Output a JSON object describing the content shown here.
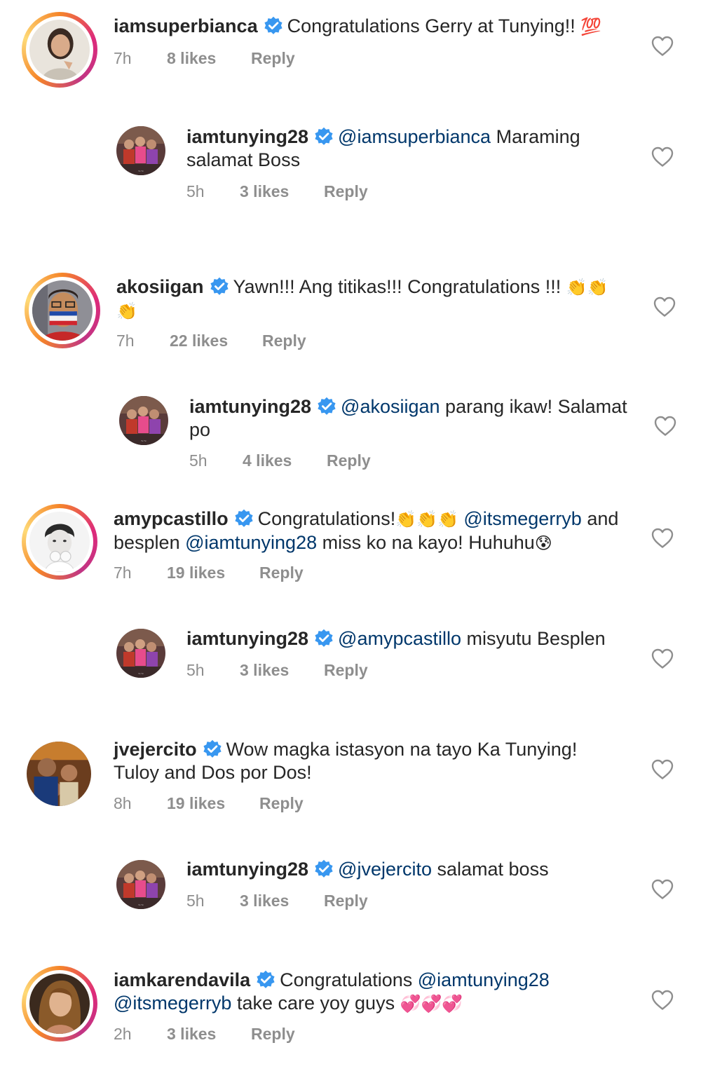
{
  "verified_color": "#3897f0",
  "mention_color": "#00376b",
  "comments": [
    {
      "username": "iamsuperbianca",
      "text_parts": [
        {
          "t": "Congratulations Gerry at Tunying!! "
        },
        {
          "emoji": "💯"
        }
      ],
      "time": "7h",
      "likes": "8 likes",
      "reply": "Reply",
      "icon": "heart-icon"
    },
    {
      "username": "iamtunying28",
      "mention": "@iamsuperbianca",
      "text1": " Maraming",
      "text2": "salamat Boss",
      "time": "5h",
      "likes": "3 likes",
      "reply": "Reply"
    },
    {
      "username": "akosiigan",
      "text1": "Yawn!!! Ang titikas!!! Congratulations !!! ",
      "emoji": "👏👏",
      "emoji2": "👏",
      "time": "7h",
      "likes": "22 likes",
      "reply": "Reply"
    },
    {
      "username": "iamtunying28",
      "mention": "@akosiigan",
      "text1": " parang ikaw! Salamat",
      "text2": "po",
      "time": "5h",
      "likes": "4 likes",
      "reply": "Reply"
    },
    {
      "username": "amypcastillo",
      "text1": "Congratulations!",
      "emoji": "👏👏👏",
      "mention1": "@itsmegerryb",
      "text2": " and",
      "text3": "besplen ",
      "mention2": "@iamtunying28",
      "text4": "  miss ko na kayo! Huhuhu",
      "emoji2": "😰",
      "time": "7h",
      "likes": "19 likes",
      "reply": "Reply"
    },
    {
      "username": "iamtunying28",
      "mention": "@amypcastillo",
      "text1": " misyutu Besplen",
      "time": "5h",
      "likes": "3 likes",
      "reply": "Reply"
    },
    {
      "username": "jvejercito",
      "text1": "Wow magka istasyon na tayo Ka Tunying!",
      "text2": "Tuloy and Dos por Dos!",
      "time": "8h",
      "likes": "19 likes",
      "reply": "Reply"
    },
    {
      "username": "iamtunying28",
      "mention": "@jvejercito",
      "text1": " salamat boss",
      "time": "5h",
      "likes": "3 likes",
      "reply": "Reply"
    },
    {
      "username": "iamkarendavila",
      "text1": "Congratulations ",
      "mention1": "@iamtunying28",
      "mention2": "@itsmegerryb",
      "text2": " take care yoy guys ",
      "emoji": "💞💞💞",
      "time": "2h",
      "likes": "3 likes",
      "reply": "Reply"
    }
  ]
}
